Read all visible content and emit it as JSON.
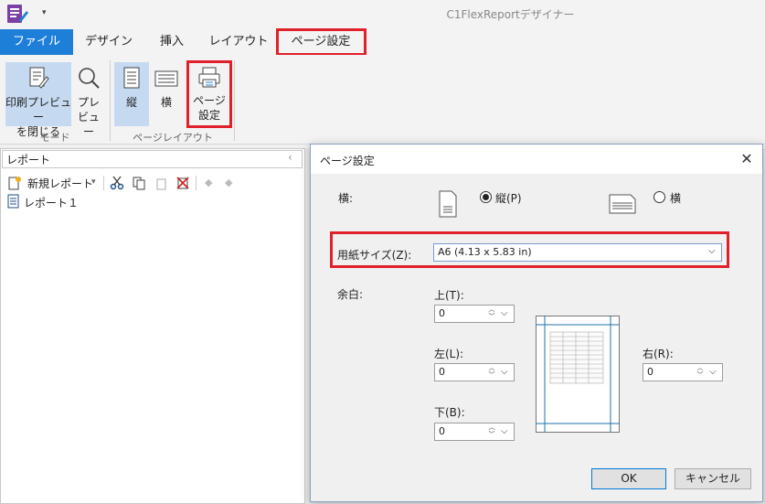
{
  "app": {
    "title": "C1FlexReportデザイナー",
    "quick_access_arrow": "▾"
  },
  "tabs": [
    "ファイル",
    "デザイン",
    "挿入",
    "レイアウト",
    "ページ設定"
  ],
  "ribbon": {
    "close_preview": [
      "印刷プレビュー",
      "を閉じる"
    ],
    "preview": [
      "プレ",
      "ビュー"
    ],
    "mode_group": "モード",
    "portrait": "縦",
    "landscape": "横",
    "page_setup": [
      "ページ",
      "設定"
    ],
    "page_layout_group": "ページレイアウト"
  },
  "panel": {
    "title": "レポート",
    "pin": "ᚲ",
    "new_report": "新規レポート",
    "report_item": "レポート１"
  },
  "dialog": {
    "title": "ページ設定",
    "close": "✕",
    "orientation_label": "横:",
    "portrait_label": "縦(P)",
    "landscape_label": "横",
    "portrait_selected": true,
    "paper_size_label": "用紙サイズ(Z):",
    "paper_size_value": "A6 (4.13 x 5.83 in)",
    "margins_label": "余白:",
    "top_label": "上(T):",
    "left_label": "左(L):",
    "right_label": "右(R):",
    "bottom_label": "下(B):",
    "top_value": "0",
    "left_value": "0",
    "right_value": "0",
    "bottom_value": "0",
    "ok": "OK",
    "cancel": "キャンセル"
  },
  "colors": {
    "accent": "#1e7fd8",
    "highlight": "#e0202a",
    "selected": "#c5d9f1"
  }
}
